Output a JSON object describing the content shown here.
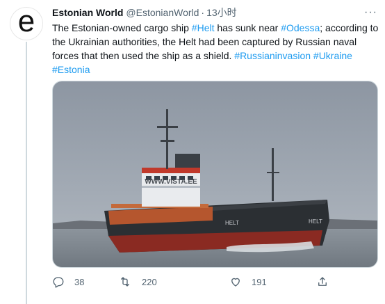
{
  "tweet": {
    "author": {
      "display_name": "Estonian World",
      "handle": "@EstonianWorld",
      "separator": "·",
      "time": "13小时",
      "avatar_letter": "e"
    },
    "more_label": "···",
    "text": {
      "p1": "The Estonian-owned cargo ship ",
      "tag_helt": "#Helt",
      "p2": " has sunk near ",
      "tag_odessa": "#Odessa",
      "p3": "; according to the Ukrainian authorities, the Helt had been captured by Russian naval forces that then used the ship as a shield. ",
      "tag_invasion": "#Russianinvasion",
      "tag_ukraine": "#Ukraine",
      "tag_estonia": "#Estonia"
    },
    "media": {
      "sign_text": "WWW.VISTA.EE",
      "hull_name": "HELT",
      "hull_name_bow": "HELT"
    },
    "actions": {
      "reply_count": "38",
      "retweet_count": "220",
      "like_count": "191"
    },
    "colors": {
      "link": "#1d9bf0",
      "muted": "#536471",
      "hull": "#2b2f33",
      "hull_bottom": "#8a2a22",
      "cargo": "#b5562e"
    }
  }
}
